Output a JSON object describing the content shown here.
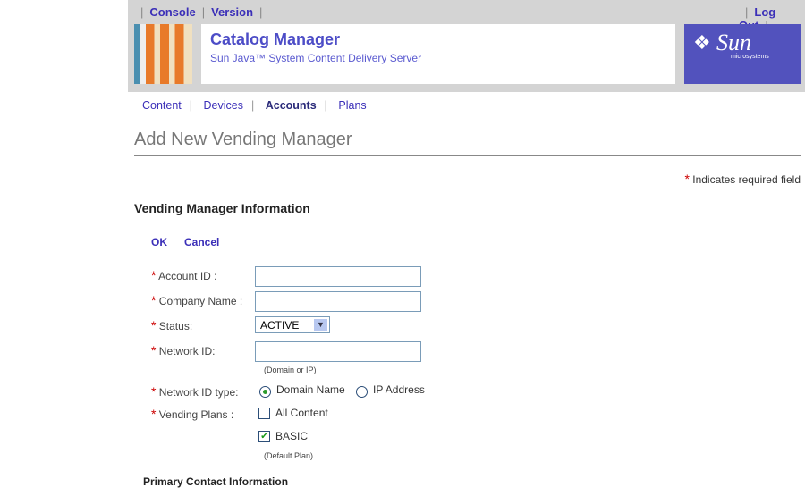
{
  "header": {
    "links_left": [
      "Console",
      "Version"
    ],
    "logout": "Log Out",
    "title": "Catalog Manager",
    "subtitle": "Sun Java™ System Content Delivery Server",
    "logo": "Sun microsystems"
  },
  "nav": {
    "items": [
      "Content",
      "Devices",
      "Accounts",
      "Plans"
    ],
    "active": "Accounts"
  },
  "page": {
    "title": "Add New Vending Manager",
    "required_note": "Indicates required field",
    "section": "Vending Manager Information",
    "ok": "OK",
    "cancel": "Cancel",
    "subsection": "Primary Contact Information"
  },
  "form": {
    "account_id": {
      "label": "Account ID :",
      "value": ""
    },
    "company_name": {
      "label": "Company Name :",
      "value": ""
    },
    "status": {
      "label": "Status:",
      "value": "ACTIVE"
    },
    "network_id": {
      "label": "Network ID:",
      "value": "",
      "hint": "(Domain or IP)"
    },
    "network_id_type": {
      "label": "Network ID type:",
      "options": [
        "Domain Name",
        "IP Address"
      ],
      "selected": "Domain Name"
    },
    "vending_plans": {
      "label": "Vending Plans :",
      "options": [
        {
          "label": "All Content",
          "checked": false
        },
        {
          "label": "BASIC",
          "checked": true
        }
      ],
      "hint": "(Default Plan)"
    }
  },
  "colors": {
    "link": "#3b2fb8",
    "header_bg": "#d4d4d4",
    "logo_bg": "#5252bd",
    "required": "#cc0000"
  }
}
